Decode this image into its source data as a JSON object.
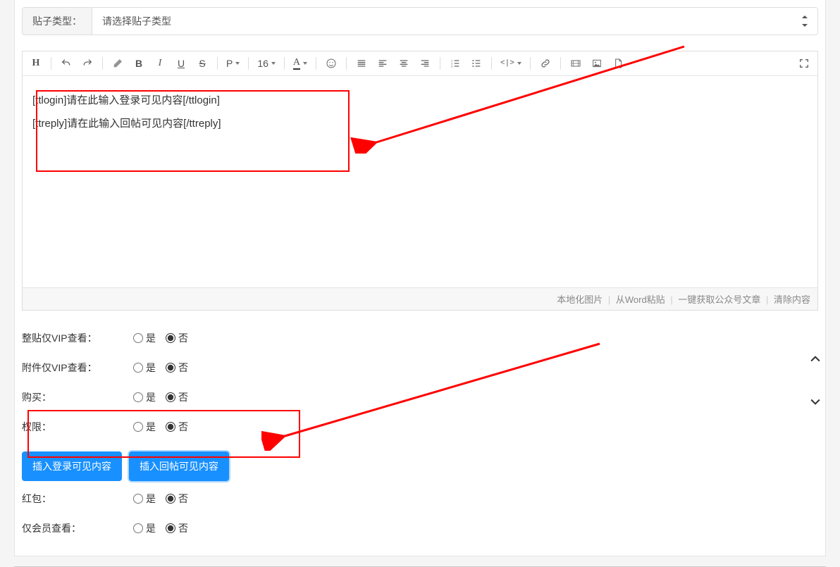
{
  "postType": {
    "label": "贴子类型：",
    "placeholder": "请选择贴子类型"
  },
  "toolbar": {
    "heading": "H",
    "para": "P",
    "fontSize": "16",
    "fontLetter": "A",
    "code": "<|>"
  },
  "editorContent": {
    "line1": "[ttlogin]请在此输入登录可见内容[/ttlogin]",
    "line2": "[ttreply]请在此输入回帖可见内容[/ttreply]"
  },
  "editorFooter": {
    "localImage": "本地化图片",
    "pasteWord": "从Word粘贴",
    "fetchWechat": "一键获取公众号文章",
    "clear": "清除内容"
  },
  "options": {
    "yes": "是",
    "no": "否",
    "vipPost": "整贴仅VIP查看：",
    "vipAttach": "附件仅VIP查看：",
    "buy": "购买：",
    "perm": "权限：",
    "redpack": "红包：",
    "memberOnly": "仅会员查看：",
    "selected": {
      "vipPost": "no",
      "vipAttach": "no",
      "buy": "no",
      "perm": "no",
      "redpack": "no",
      "memberOnly": "no"
    }
  },
  "buttons": {
    "insertLogin": "插入登录可见内容",
    "insertReply": "插入回帖可见内容"
  }
}
